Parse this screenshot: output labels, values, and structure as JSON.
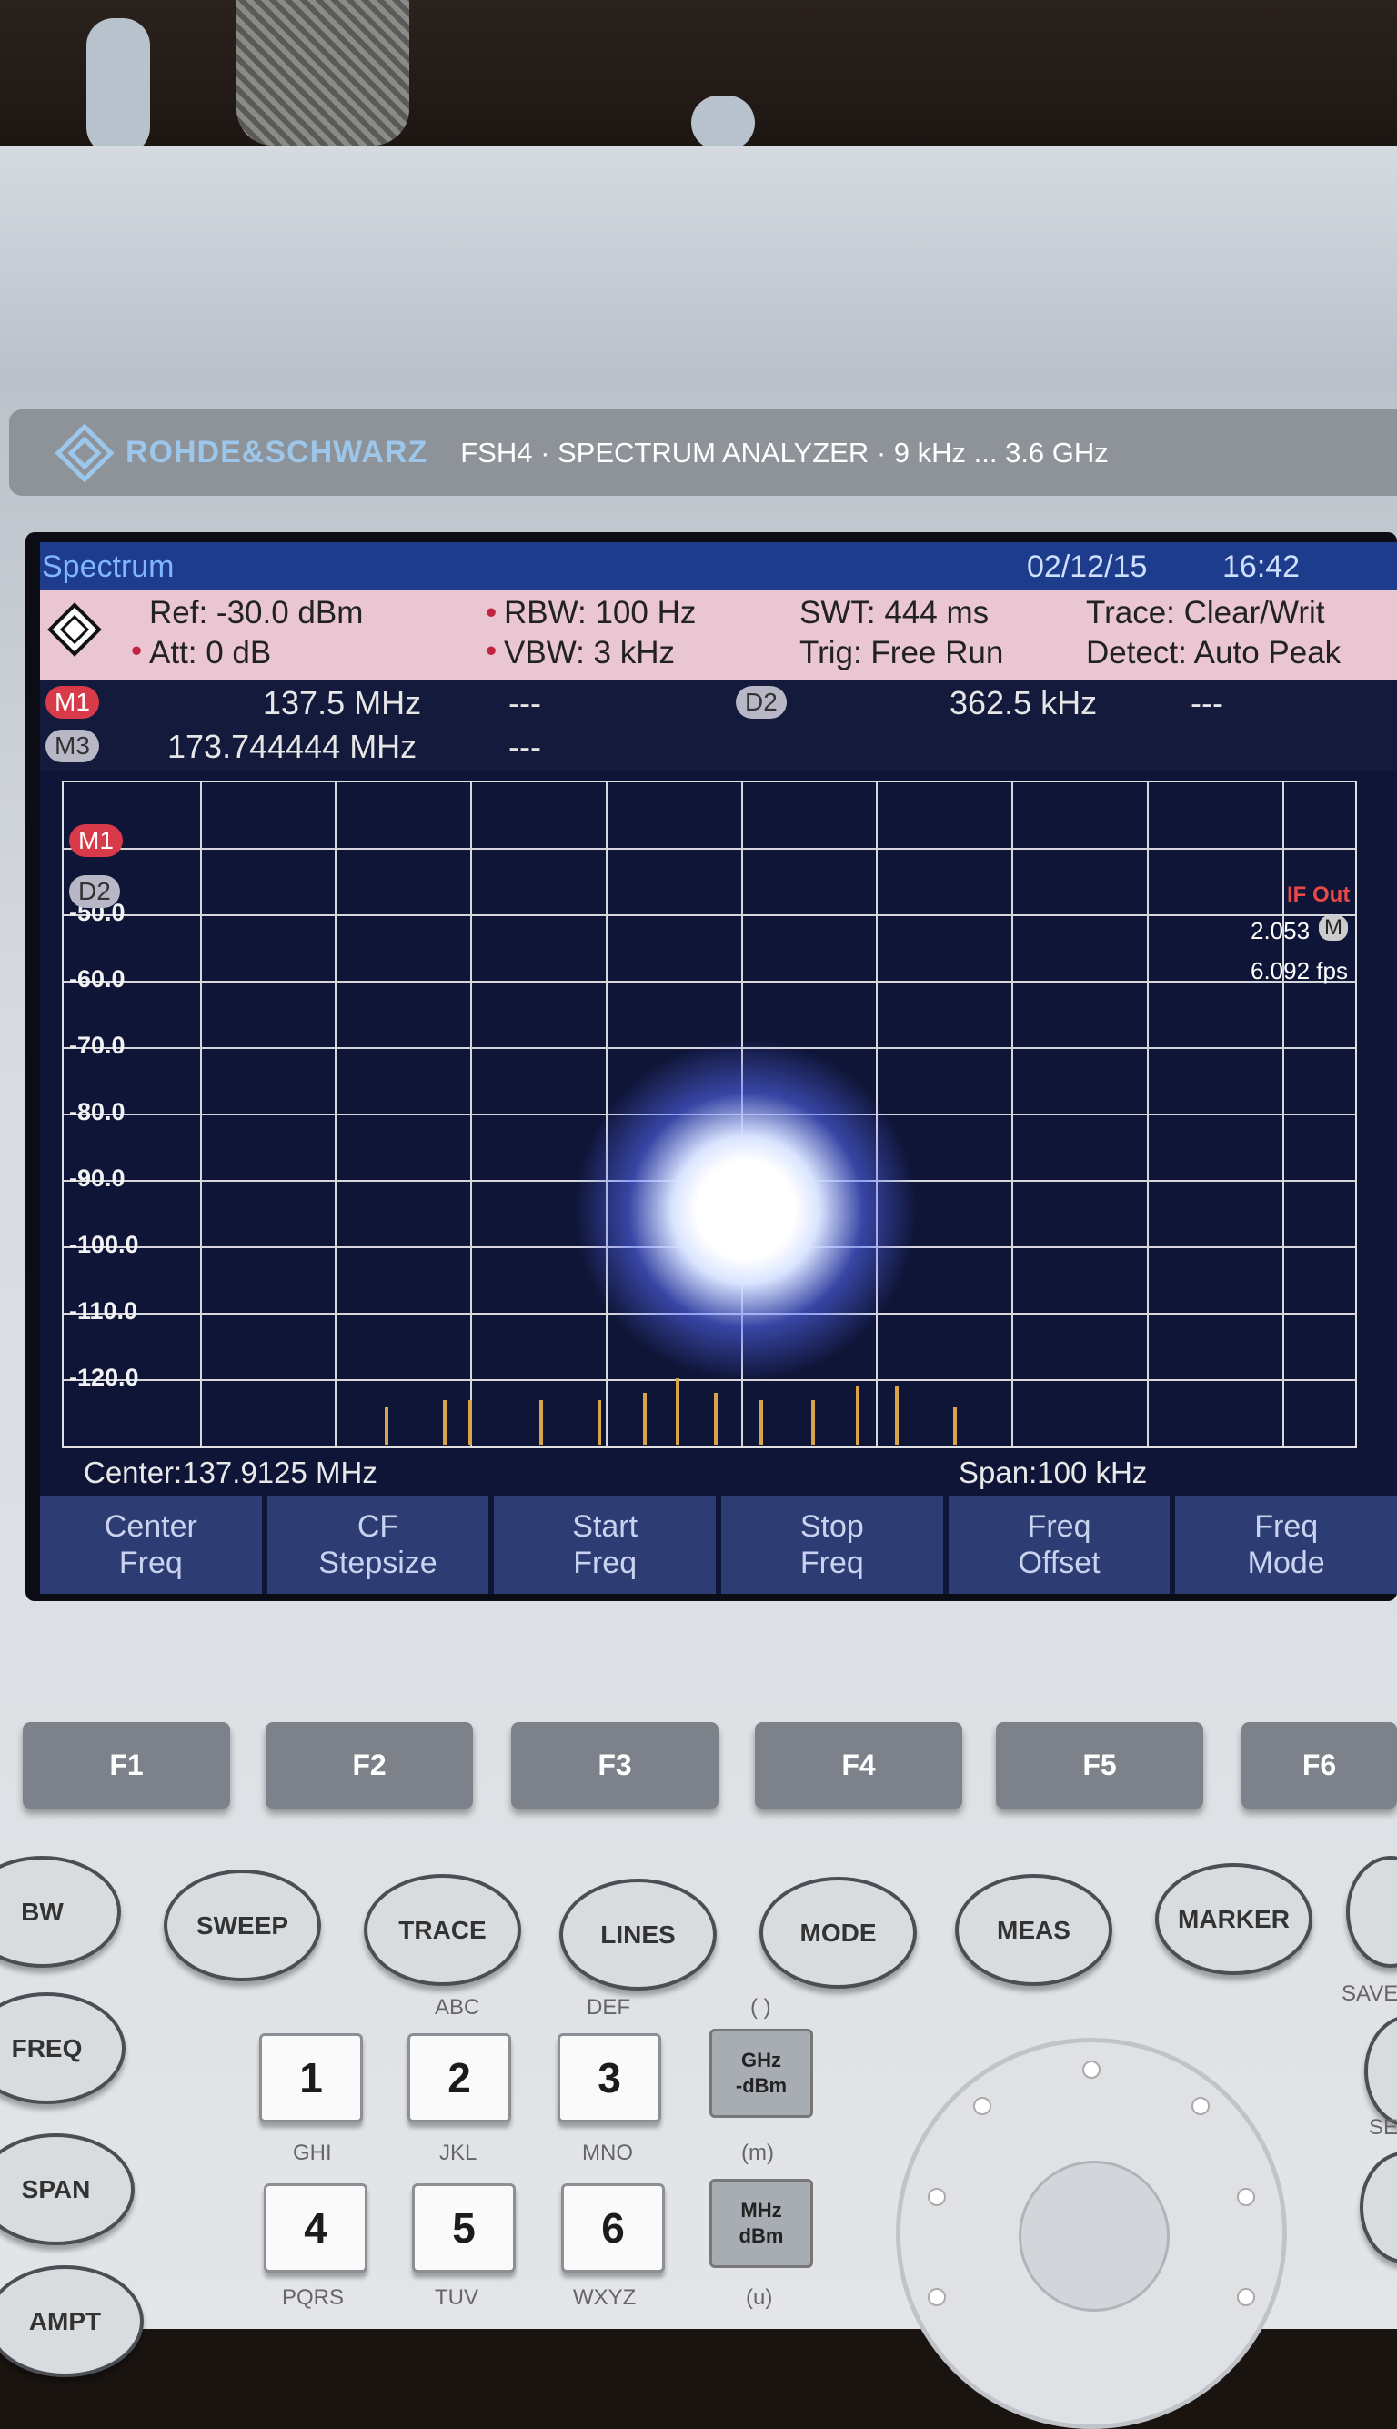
{
  "brand": {
    "name": "ROHDE&SCHWARZ",
    "model": "FSH4 · SPECTRUM ANALYZER · 9 kHz ... 3.6 GHz"
  },
  "screen": {
    "mode": "Spectrum",
    "date": "02/12/15",
    "time": "16:42",
    "ref": "Ref: -30.0 dBm",
    "att": "Att: 0 dB",
    "rbw": "RBW: 100 Hz",
    "vbw": "VBW: 3 kHz",
    "swt": "SWT: 444 ms",
    "trig": "Trig: Free Run",
    "trace": "Trace: Clear/Writ",
    "detect": "Detect: Auto Peak",
    "markers": [
      {
        "label": "M1",
        "value": "137.5 MHz",
        "level": "---"
      },
      {
        "label": "M3",
        "value": "173.744444 MHz",
        "level": "---"
      },
      {
        "label": "D2",
        "value": "362.5 kHz",
        "level": "---"
      }
    ],
    "plot_markers": {
      "m1": "M1",
      "d2": "D2"
    },
    "if_out": "IF Out",
    "right_values": [
      "2.053",
      "6.092 fps"
    ],
    "right_tag": "M",
    "y_ticks": [
      "-50.0",
      "-60.0",
      "-70.0",
      "-80.0",
      "-90.0",
      "-100.0",
      "-110.0",
      "-120.0"
    ],
    "center": "Center:137.9125 MHz",
    "span": "Span:100 kHz",
    "softkeys": [
      {
        "l1": "Center",
        "l2": "Freq"
      },
      {
        "l1": "CF",
        "l2": "Stepsize"
      },
      {
        "l1": "Start",
        "l2": "Freq"
      },
      {
        "l1": "Stop",
        "l2": "Freq"
      },
      {
        "l1": "Freq",
        "l2": "Offset"
      },
      {
        "l1": "Freq",
        "l2": "Mode"
      }
    ],
    "spectrum": {
      "peaks_offset_pct": [
        -50,
        -41,
        -37,
        -26,
        -17,
        -10,
        -5,
        1,
        8,
        16,
        23,
        29,
        38
      ],
      "peak_levels_dBm": [
        -125,
        -124,
        -124,
        -124,
        -124,
        -123,
        -121,
        -123,
        -124,
        -124,
        -122,
        -122,
        -125
      ]
    }
  },
  "fkeys": [
    "F1",
    "F2",
    "F3",
    "F4",
    "F5",
    "F6"
  ],
  "hardkeys": {
    "row1": [
      "BW",
      "SWEEP",
      "TRACE",
      "LINES",
      "MODE",
      "MEAS",
      "MARKER"
    ],
    "left": [
      "FREQ",
      "SPAN",
      "AMPT"
    ],
    "numpad": [
      "1",
      "2",
      "3",
      "4",
      "5",
      "6"
    ],
    "letters_top": [
      "ABC",
      "DEF",
      "( )"
    ],
    "letters_mid": [
      "GHI",
      "JKL",
      "MNO",
      "(m)"
    ],
    "letters_bot": [
      "PQRS",
      "TUV",
      "WXYZ",
      "(u)"
    ],
    "unit1": {
      "l1": "GHz",
      "l2": "-dBm"
    },
    "unit2": {
      "l1": "MHz",
      "l2": "dBm"
    },
    "save": "SAVE",
    "se": "SE"
  }
}
